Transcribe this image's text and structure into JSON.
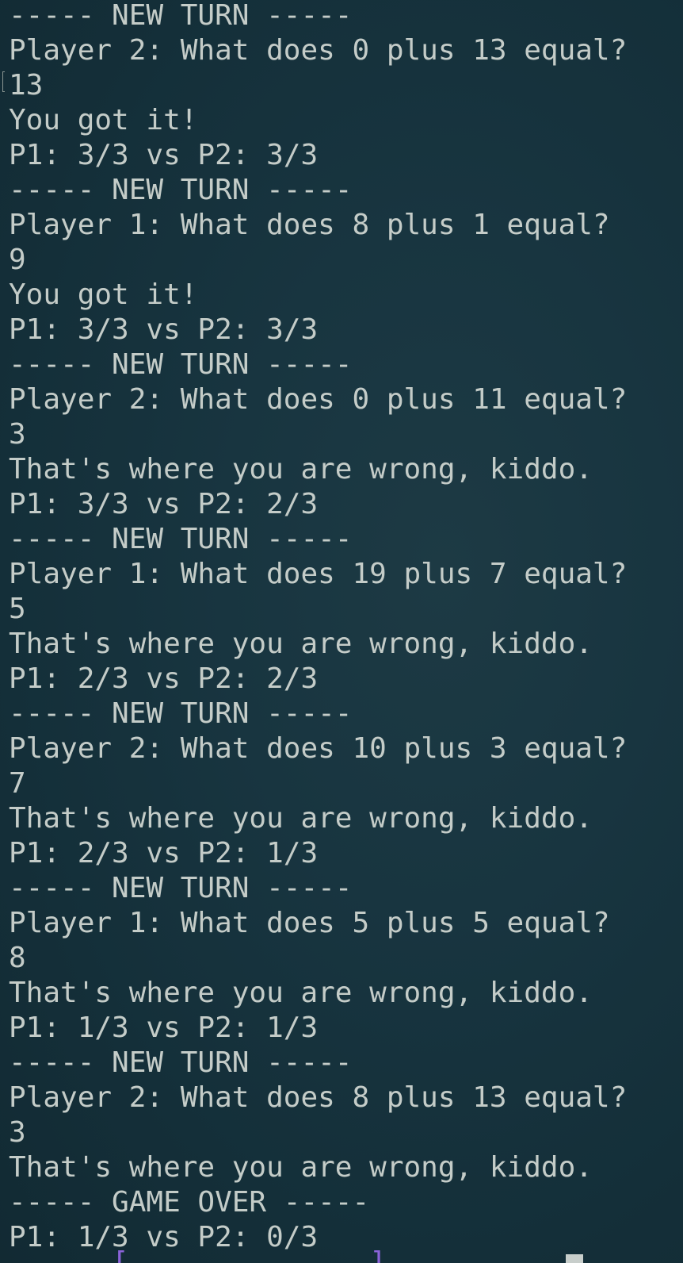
{
  "terminal": {
    "lines": [
      {
        "text": "----- NEW TURN -----",
        "kind": "separator"
      },
      {
        "text": "Player 2: What does 0 plus 13 equal?",
        "kind": "question"
      },
      {
        "text": "13",
        "kind": "input"
      },
      {
        "text": "You got it!",
        "kind": "result"
      },
      {
        "text": "P1: 3/3 vs P2: 3/3",
        "kind": "score"
      },
      {
        "text": "----- NEW TURN -----",
        "kind": "separator"
      },
      {
        "text": "Player 1: What does 8 plus 1 equal?",
        "kind": "question"
      },
      {
        "text": "9",
        "kind": "input"
      },
      {
        "text": "You got it!",
        "kind": "result"
      },
      {
        "text": "P1: 3/3 vs P2: 3/3",
        "kind": "score"
      },
      {
        "text": "----- NEW TURN -----",
        "kind": "separator"
      },
      {
        "text": "Player 2: What does 0 plus 11 equal?",
        "kind": "question"
      },
      {
        "text": "3",
        "kind": "input"
      },
      {
        "text": "That's where you are wrong, kiddo.",
        "kind": "result"
      },
      {
        "text": "P1: 3/3 vs P2: 2/3",
        "kind": "score"
      },
      {
        "text": "----- NEW TURN -----",
        "kind": "separator"
      },
      {
        "text": "Player 1: What does 19 plus 7 equal?",
        "kind": "question"
      },
      {
        "text": "5",
        "kind": "input"
      },
      {
        "text": "That's where you are wrong, kiddo.",
        "kind": "result"
      },
      {
        "text": "P1: 2/3 vs P2: 2/3",
        "kind": "score"
      },
      {
        "text": "----- NEW TURN -----",
        "kind": "separator"
      },
      {
        "text": "Player 2: What does 10 plus 3 equal?",
        "kind": "question"
      },
      {
        "text": "7",
        "kind": "input"
      },
      {
        "text": "That's where you are wrong, kiddo.",
        "kind": "result"
      },
      {
        "text": "P1: 2/3 vs P2: 1/3",
        "kind": "score"
      },
      {
        "text": "----- NEW TURN -----",
        "kind": "separator"
      },
      {
        "text": "Player 1: What does 5 plus 5 equal?",
        "kind": "question"
      },
      {
        "text": "8",
        "kind": "input"
      },
      {
        "text": "That's where you are wrong, kiddo.",
        "kind": "result"
      },
      {
        "text": "P1: 1/3 vs P2: 1/3",
        "kind": "score"
      },
      {
        "text": "----- NEW TURN -----",
        "kind": "separator"
      },
      {
        "text": "Player 2: What does 8 plus 13 equal?",
        "kind": "question"
      },
      {
        "text": "3",
        "kind": "input"
      },
      {
        "text": "That's where you are wrong, kiddo.",
        "kind": "result"
      },
      {
        "text": "----- GAME OVER -----",
        "kind": "separator"
      },
      {
        "text": "P1: 1/3 vs P2: 0/3",
        "kind": "score"
      }
    ]
  },
  "colors": {
    "background": "#14303a",
    "text": "#c4ccc8",
    "prompt_bracket": "#8b63d9",
    "prompt_branch": "#d6705c",
    "cursor": "#c8cecb"
  }
}
